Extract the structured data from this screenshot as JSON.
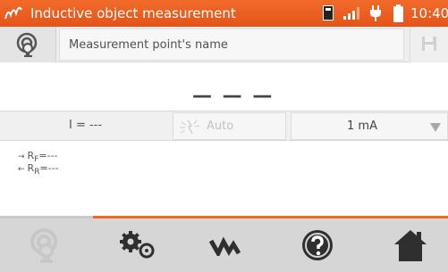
{
  "titlebar": {
    "title": "Inductive object measurement",
    "clock": "10:40",
    "accent_color": "#ee6a24",
    "icons": [
      "logo-icon",
      "sd-card-icon",
      "signal-icon",
      "plug-icon",
      "battery-icon"
    ]
  },
  "name_row": {
    "placeholder": "Measurement point's name",
    "icons": [
      "resistance-symbol-icon",
      "pencil-icon",
      "save-icon"
    ]
  },
  "main": {
    "value": "— — —"
  },
  "controls": {
    "current": "I = ---",
    "auto_label": "Auto",
    "range_value": "1 mA"
  },
  "results": {
    "rf_main": "R",
    "rf_sub": "F",
    "rf_val": "=---",
    "rr_main": "R",
    "rr_sub": "R",
    "rr_val": "=---"
  },
  "bottom_nav": {
    "items": [
      "resistance-measurement-icon",
      "settings-icon",
      "waveform-icon",
      "help-icon",
      "home-icon"
    ]
  }
}
